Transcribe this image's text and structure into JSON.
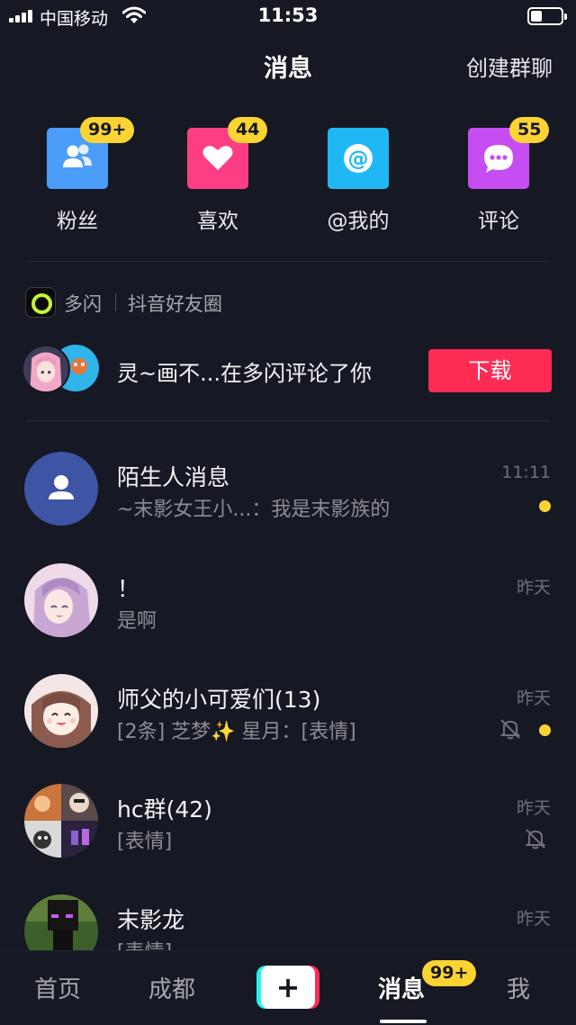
{
  "status_bar": {
    "carrier": "中国移动",
    "time": "11:53"
  },
  "header": {
    "title": "消息",
    "create_group": "创建群聊"
  },
  "quick_entries": [
    {
      "label": "粉丝",
      "badge": "99+",
      "color": "#4a9df8",
      "icon": "fans-icon"
    },
    {
      "label": "喜欢",
      "badge": "44",
      "color": "#fe3e84",
      "icon": "heart-icon"
    },
    {
      "label": "@我的",
      "badge": "",
      "color": "#1fb8f4",
      "icon": "at-icon"
    },
    {
      "label": "评论",
      "badge": "55",
      "color": "#c64df2",
      "icon": "comment-icon"
    }
  ],
  "duoshan": {
    "name": "多闪",
    "circle": "抖音好友圈",
    "message": "灵~画不...在多闪评论了你",
    "download": "下载"
  },
  "chats": [
    {
      "name": "陌生人消息",
      "preview": "~末影女王小...：我是末影族的",
      "time": "11:11",
      "unread": true,
      "muted": false,
      "avatar": "stranger-icon"
    },
    {
      "name": "！",
      "preview": "是啊",
      "time": "昨天",
      "unread": false,
      "muted": false,
      "avatar": "anime-girl-avatar"
    },
    {
      "name": "师父的小可爱们(13)",
      "preview": "[2条] 芝梦✨ 星月：[表情]",
      "time": "昨天",
      "unread": true,
      "muted": true,
      "avatar": "anime-smile-avatar"
    },
    {
      "name": "hc群(42)",
      "preview": "[表情]",
      "time": "昨天",
      "unread": false,
      "muted": true,
      "avatar": "group-collage-avatar"
    },
    {
      "name": "末影龙",
      "preview": "[表情]",
      "time": "昨天",
      "unread": false,
      "muted": false,
      "avatar": "enderman-avatar"
    }
  ],
  "tabbar": {
    "tabs": [
      "首页",
      "成都",
      "消息",
      "我"
    ],
    "active": "消息",
    "message_badge": "99+",
    "plus": "+"
  }
}
